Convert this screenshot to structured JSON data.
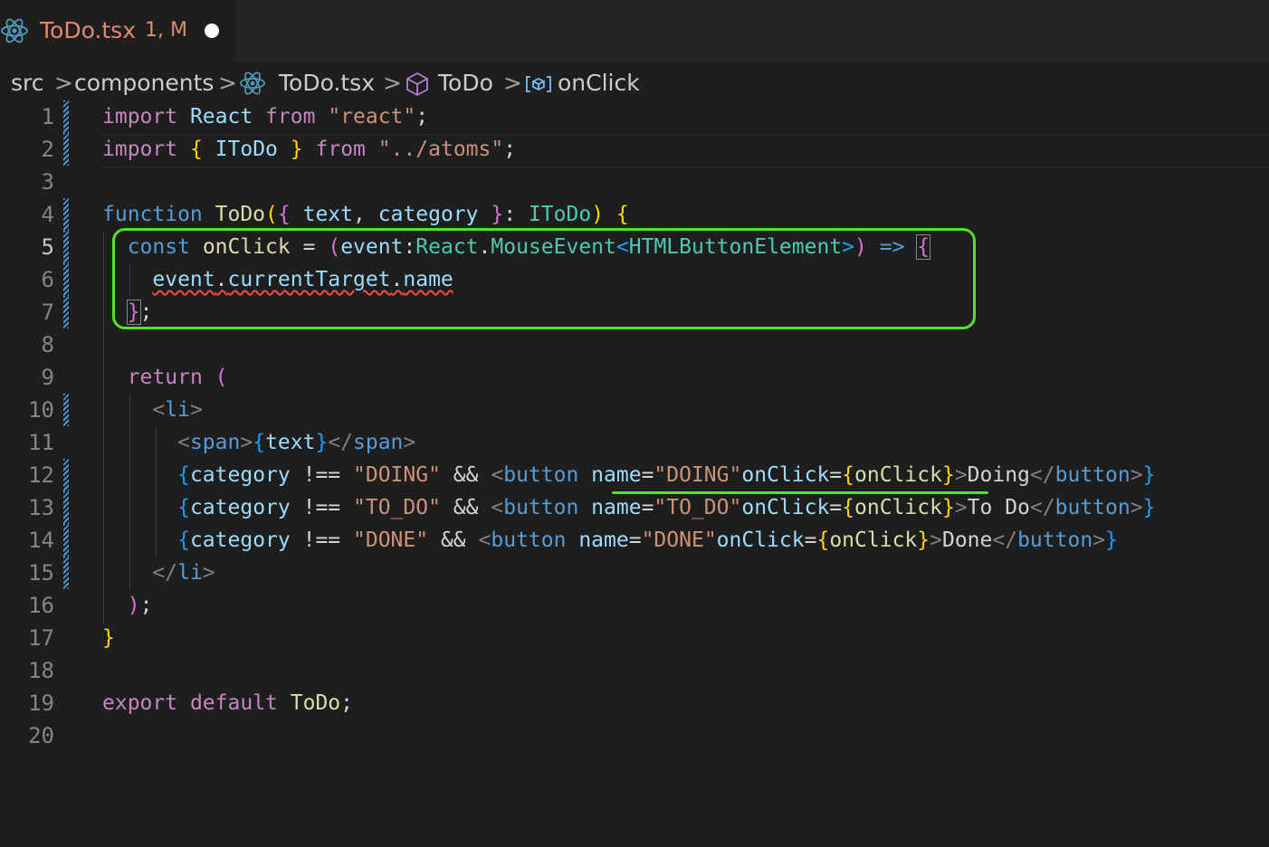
{
  "tab": {
    "filename": "ToDo.tsx",
    "badge": "1, M"
  },
  "breadcrumb": {
    "items": [
      "src",
      "components",
      "ToDo.tsx",
      "ToDo",
      "onClick"
    ],
    "separator": ">"
  },
  "line_numbers": [
    "1",
    "2",
    "3",
    "4",
    "5",
    "6",
    "7",
    "8",
    "9",
    "10",
    "11",
    "12",
    "13",
    "14",
    "15",
    "16",
    "17",
    "18",
    "19",
    "20"
  ],
  "active_line": "5",
  "code": {
    "l1": [
      "import",
      "React",
      "from",
      "\"react\"",
      ";"
    ],
    "l2": [
      "import",
      "{",
      "IToDo",
      "}",
      "from",
      "\"../atoms\"",
      ";"
    ],
    "l4": [
      "function",
      "ToDo",
      "(",
      "{",
      "text",
      ",",
      "category",
      "}",
      ":",
      "IToDo",
      ")",
      "{"
    ],
    "l5": [
      "const",
      "onClick",
      "=",
      "(",
      "event",
      ":",
      "React",
      ".",
      "MouseEvent",
      "<",
      "HTMLButtonElement",
      ">",
      ")",
      "=>",
      "{"
    ],
    "l6": [
      "event",
      ".",
      "currentTarget",
      ".",
      "name"
    ],
    "l7": [
      "}",
      ";"
    ],
    "l9": [
      "return",
      "("
    ],
    "l10": [
      "<",
      "li",
      ">"
    ],
    "l11": [
      "<",
      "span",
      ">",
      "{",
      "text",
      "}",
      "</",
      "span",
      ">"
    ],
    "l12": [
      "{",
      "category",
      "!==",
      "\"DOING\"",
      "&&",
      "<",
      "button",
      "name",
      "=",
      "\"DOING\"",
      "onClick",
      "=",
      "{",
      "onClick",
      "}",
      ">",
      "Doing",
      "</",
      "button",
      ">",
      "}"
    ],
    "l13": [
      "{",
      "category",
      "!==",
      "\"TO_DO\"",
      "&&",
      "<",
      "button",
      "name",
      "=",
      "\"TO_DO\"",
      "onClick",
      "=",
      "{",
      "onClick",
      "}",
      ">",
      "To Do",
      "</",
      "button",
      ">",
      "}"
    ],
    "l14": [
      "{",
      "category",
      "!==",
      "\"DONE\"",
      "&&",
      "<",
      "button",
      "name",
      "=",
      "\"DONE\"",
      "onClick",
      "=",
      "{",
      "onClick",
      "}",
      ">",
      "Done",
      "</",
      "button",
      ">",
      "}"
    ],
    "l15": [
      "</",
      "li",
      ">"
    ],
    "l16": [
      ")",
      ";"
    ],
    "l17": [
      "}"
    ],
    "l19": [
      "export",
      "default",
      "ToDo",
      ";"
    ]
  },
  "colors": {
    "highlight_box": "#56e02c",
    "error_squiggle": "#f14c4c",
    "tab_modified": "#e2896f"
  },
  "icons": {
    "tab": "react-icon",
    "breadcrumb_file": "react-icon",
    "breadcrumb_component": "cube-icon",
    "breadcrumb_variable": "variable-icon"
  }
}
